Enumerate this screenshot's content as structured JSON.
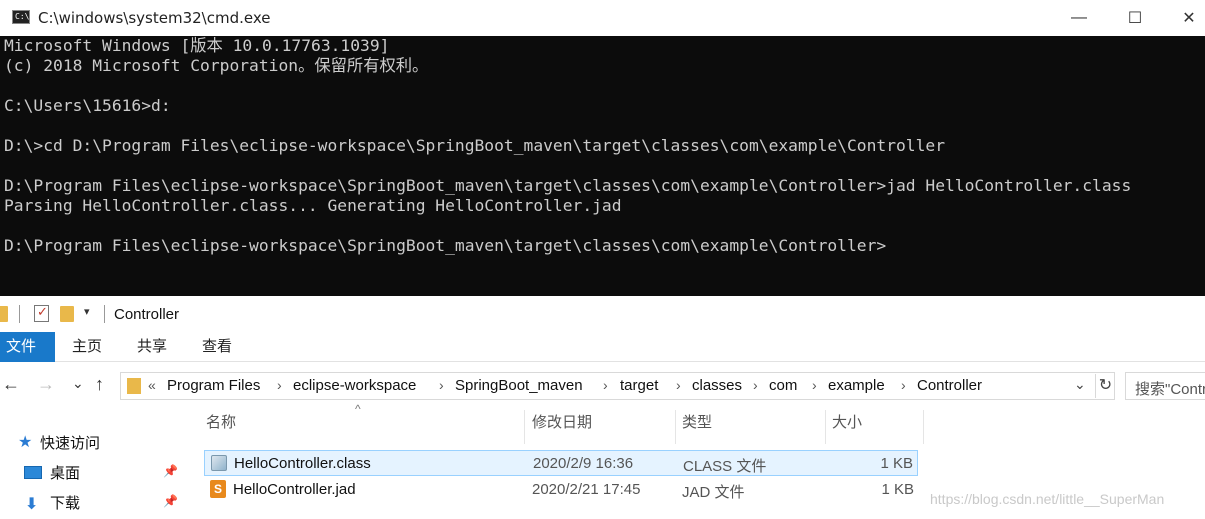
{
  "cmd": {
    "title": "C:\\windows\\system32\\cmd.exe",
    "app_icon_text": "C:\\",
    "min_glyph": "—",
    "max_glyph": "☐",
    "close_glyph": "✕",
    "lines": [
      "Microsoft Windows [版本 10.0.17763.1039]",
      "(c) 2018 Microsoft Corporation。保留所有权利。",
      "",
      "C:\\Users\\15616>d:",
      "",
      "D:\\>cd D:\\Program Files\\eclipse-workspace\\SpringBoot_maven\\target\\classes\\com\\example\\Controller",
      "",
      "D:\\Program Files\\eclipse-workspace\\SpringBoot_maven\\target\\classes\\com\\example\\Controller>jad HelloController.class",
      "Parsing HelloController.class... Generating HelloController.jad",
      "",
      "D:\\Program Files\\eclipse-workspace\\SpringBoot_maven\\target\\classes\\com\\example\\Controller>"
    ]
  },
  "explorer": {
    "qat_title": "Controller",
    "qat_drop": "▾",
    "ribbon_tabs": {
      "file": "文件",
      "home": "主页",
      "share": "共享",
      "view": "查看"
    },
    "nav": {
      "back": "←",
      "forward": "→",
      "recent": "⌄",
      "up": "↑"
    },
    "address": {
      "overflow": "«",
      "crumbs": [
        "Program Files",
        "eclipse-workspace",
        "SpringBoot_maven",
        "target",
        "classes",
        "com",
        "example",
        "Controller"
      ],
      "dropdown": "⌄",
      "refresh": "↻"
    },
    "search_placeholder": "搜索\"Controller\"",
    "nav_pane": {
      "quick_access": "快速访问",
      "desktop": "桌面",
      "downloads": "下载",
      "pin": "📌"
    },
    "columns": {
      "name": "名称",
      "date": "修改日期",
      "type": "类型",
      "size": "大小"
    },
    "sort_glyph": "^",
    "files": [
      {
        "name": "HelloController.class",
        "date": "2020/2/9 16:36",
        "type": "CLASS 文件",
        "size": "1 KB"
      },
      {
        "name": "HelloController.jad",
        "date": "2020/2/21 17:45",
        "type": "JAD 文件",
        "size": "1 KB"
      }
    ],
    "watermark": "https://blog.csdn.net/little__SuperMan"
  }
}
